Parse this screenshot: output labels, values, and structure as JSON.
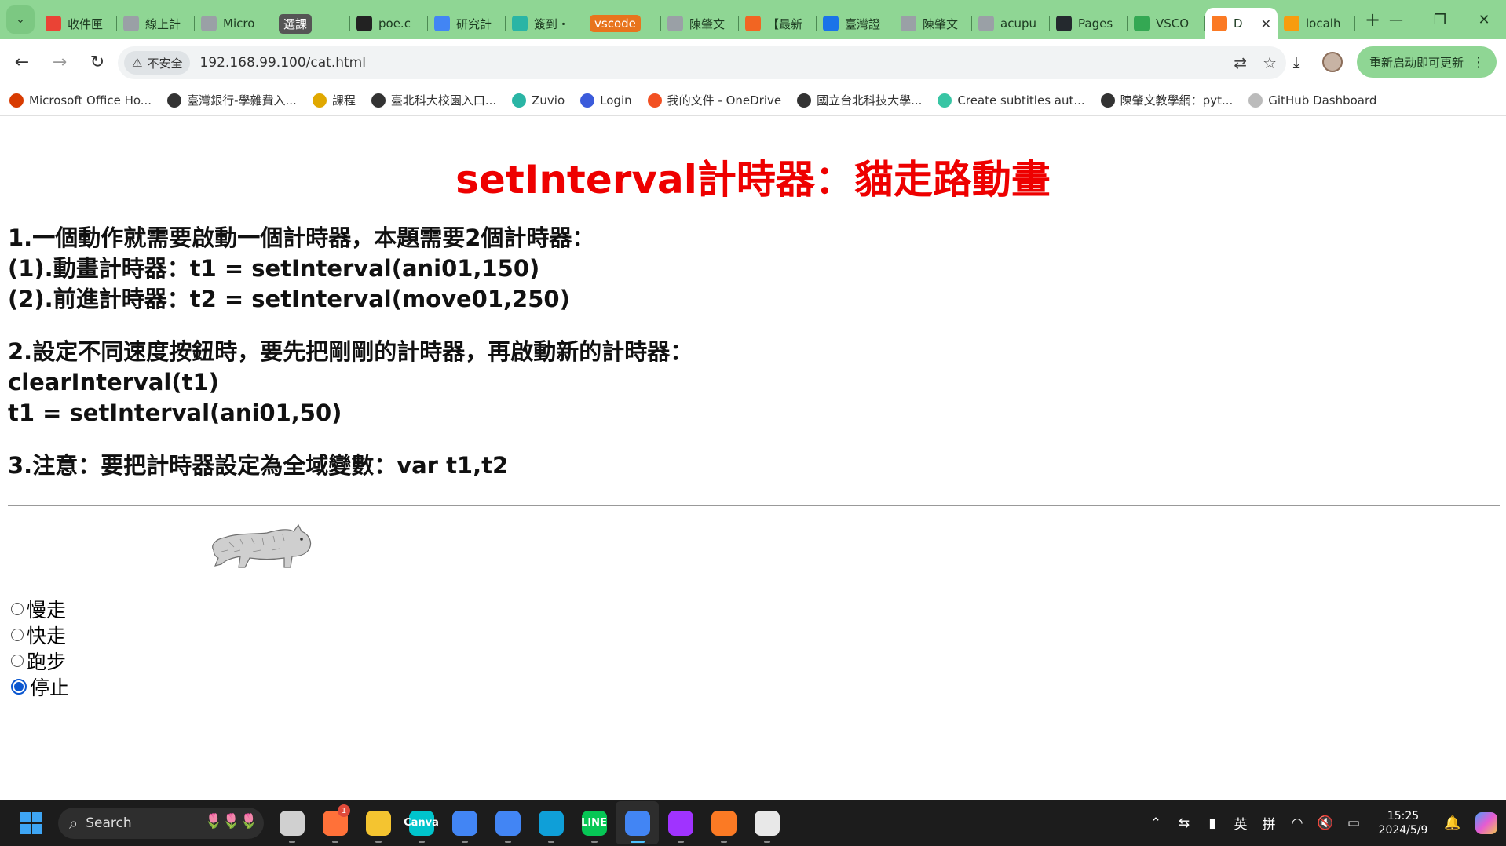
{
  "browser": {
    "tabs": [
      {
        "title": "收件匣",
        "icon": "gmail-icon",
        "color": "#ea4335"
      },
      {
        "title": "線上計",
        "icon": "globe-icon",
        "color": "#9aa0a6"
      },
      {
        "title": "Micro",
        "icon": "globe-icon",
        "color": "#9aa0a6"
      },
      {
        "title": "選課",
        "icon": "",
        "color": "",
        "style": "pill2"
      },
      {
        "title": "poe.c",
        "icon": "poe-icon",
        "color": "#222222"
      },
      {
        "title": "研究計",
        "icon": "docs-icon",
        "color": "#4285f4"
      },
      {
        "title": "簽到・",
        "icon": "zuvio-icon",
        "color": "#2ab5a5"
      },
      {
        "title": "vscode",
        "icon": "",
        "color": "",
        "style": "pill"
      },
      {
        "title": "陳肇文",
        "icon": "globe-icon",
        "color": "#9aa0a6"
      },
      {
        "title": "【最新",
        "icon": "104-icon",
        "color": "#f26522"
      },
      {
        "title": "臺灣證",
        "icon": "twse-icon",
        "color": "#1a73e8"
      },
      {
        "title": "陳肇文",
        "icon": "globe-icon",
        "color": "#9aa0a6"
      },
      {
        "title": "acupu",
        "icon": "globe-icon",
        "color": "#9aa0a6"
      },
      {
        "title": "Pages",
        "icon": "github-icon",
        "color": "#24292e"
      },
      {
        "title": "VSCO",
        "icon": "drive-icon",
        "color": "#34a853"
      },
      {
        "title": "D",
        "icon": "xampp-icon",
        "color": "#fb7a24",
        "active": true
      },
      {
        "title": "localh",
        "icon": "phpmyadmin-icon",
        "color": "#f89c0e"
      }
    ],
    "new_tab_label": "+",
    "security_label": "不安全",
    "url": "192.168.99.100/cat.html",
    "update_button": "重新启动即可更新",
    "bookmarks": [
      {
        "label": "Microsoft Office Ho...",
        "icon": "office-icon",
        "color": "#d83b01"
      },
      {
        "label": "臺灣銀行-學雜費入...",
        "icon": "globe-icon",
        "color": "#333333"
      },
      {
        "label": "課程",
        "icon": "course-icon",
        "color": "#e0a800"
      },
      {
        "label": "臺北科大校園入口...",
        "icon": "globe-icon",
        "color": "#333333"
      },
      {
        "label": "Zuvio",
        "icon": "zuvio-icon",
        "color": "#2ab5a5"
      },
      {
        "label": "Login",
        "icon": "login-icon",
        "color": "#3b5bdb"
      },
      {
        "label": "我的文件 - OneDrive",
        "icon": "microsoft-icon",
        "color": "#f25022"
      },
      {
        "label": "國立台北科技大學...",
        "icon": "globe-icon",
        "color": "#333333"
      },
      {
        "label": "Create subtitles aut...",
        "icon": "subtitles-icon",
        "color": "#38c5a4"
      },
      {
        "label": "陳肇文教學網：pyt...",
        "icon": "globe-icon",
        "color": "#333333"
      },
      {
        "label": "GitHub Dashboard",
        "icon": "github-icon",
        "color": "#bbbbbb"
      }
    ]
  },
  "page": {
    "title": "setInterval計時器：貓走路動畫",
    "notes": [
      [
        "1.一個動作就需要啟動一個計時器，本題需要2個計時器：",
        "(1).動畫計時器：t1 = setInterval(ani01,150)",
        "(2).前進計時器：t2 = setInterval(move01,250)"
      ],
      [
        "2.設定不同速度按鈕時，要先把剛剛的計時器，再啟動新的計時器：",
        "clearInterval(t1)",
        "t1 = setInterval(ani01,50)"
      ],
      [
        "3.注意：要把計時器設定為全域變數：var t1,t2"
      ]
    ],
    "speed_options": [
      {
        "label": "慢走",
        "checked": false
      },
      {
        "label": "快走",
        "checked": false
      },
      {
        "label": "跑步",
        "checked": false
      },
      {
        "label": "停止",
        "checked": true
      }
    ]
  },
  "taskbar": {
    "search_placeholder": "Search",
    "apps": [
      {
        "name": "task-view-icon",
        "color": "#d0d0d0"
      },
      {
        "name": "firefox-icon",
        "color": "#ff7139",
        "badge": "1"
      },
      {
        "name": "file-explorer-icon",
        "color": "#f4c430"
      },
      {
        "name": "canva-icon",
        "color": "#00c4cc",
        "label": "Canva"
      },
      {
        "name": "chrome-icon",
        "color": "#4285f4"
      },
      {
        "name": "chrome-profile-icon",
        "color": "#4285f4"
      },
      {
        "name": "edge-icon",
        "color": "#0f9fd8"
      },
      {
        "name": "line-icon",
        "color": "#06c755",
        "label": "LINE"
      },
      {
        "name": "chrome-active-icon",
        "color": "#4285f4",
        "active": true
      },
      {
        "name": "messenger-icon",
        "color": "#a033ff"
      },
      {
        "name": "xampp-icon",
        "color": "#fb7a24"
      },
      {
        "name": "snipping-tool-icon",
        "color": "#e8e8e8"
      }
    ],
    "tray": {
      "ime_lang": "英",
      "ime_mode": "拼",
      "time": "15:25",
      "date": "2024/5/9"
    }
  }
}
